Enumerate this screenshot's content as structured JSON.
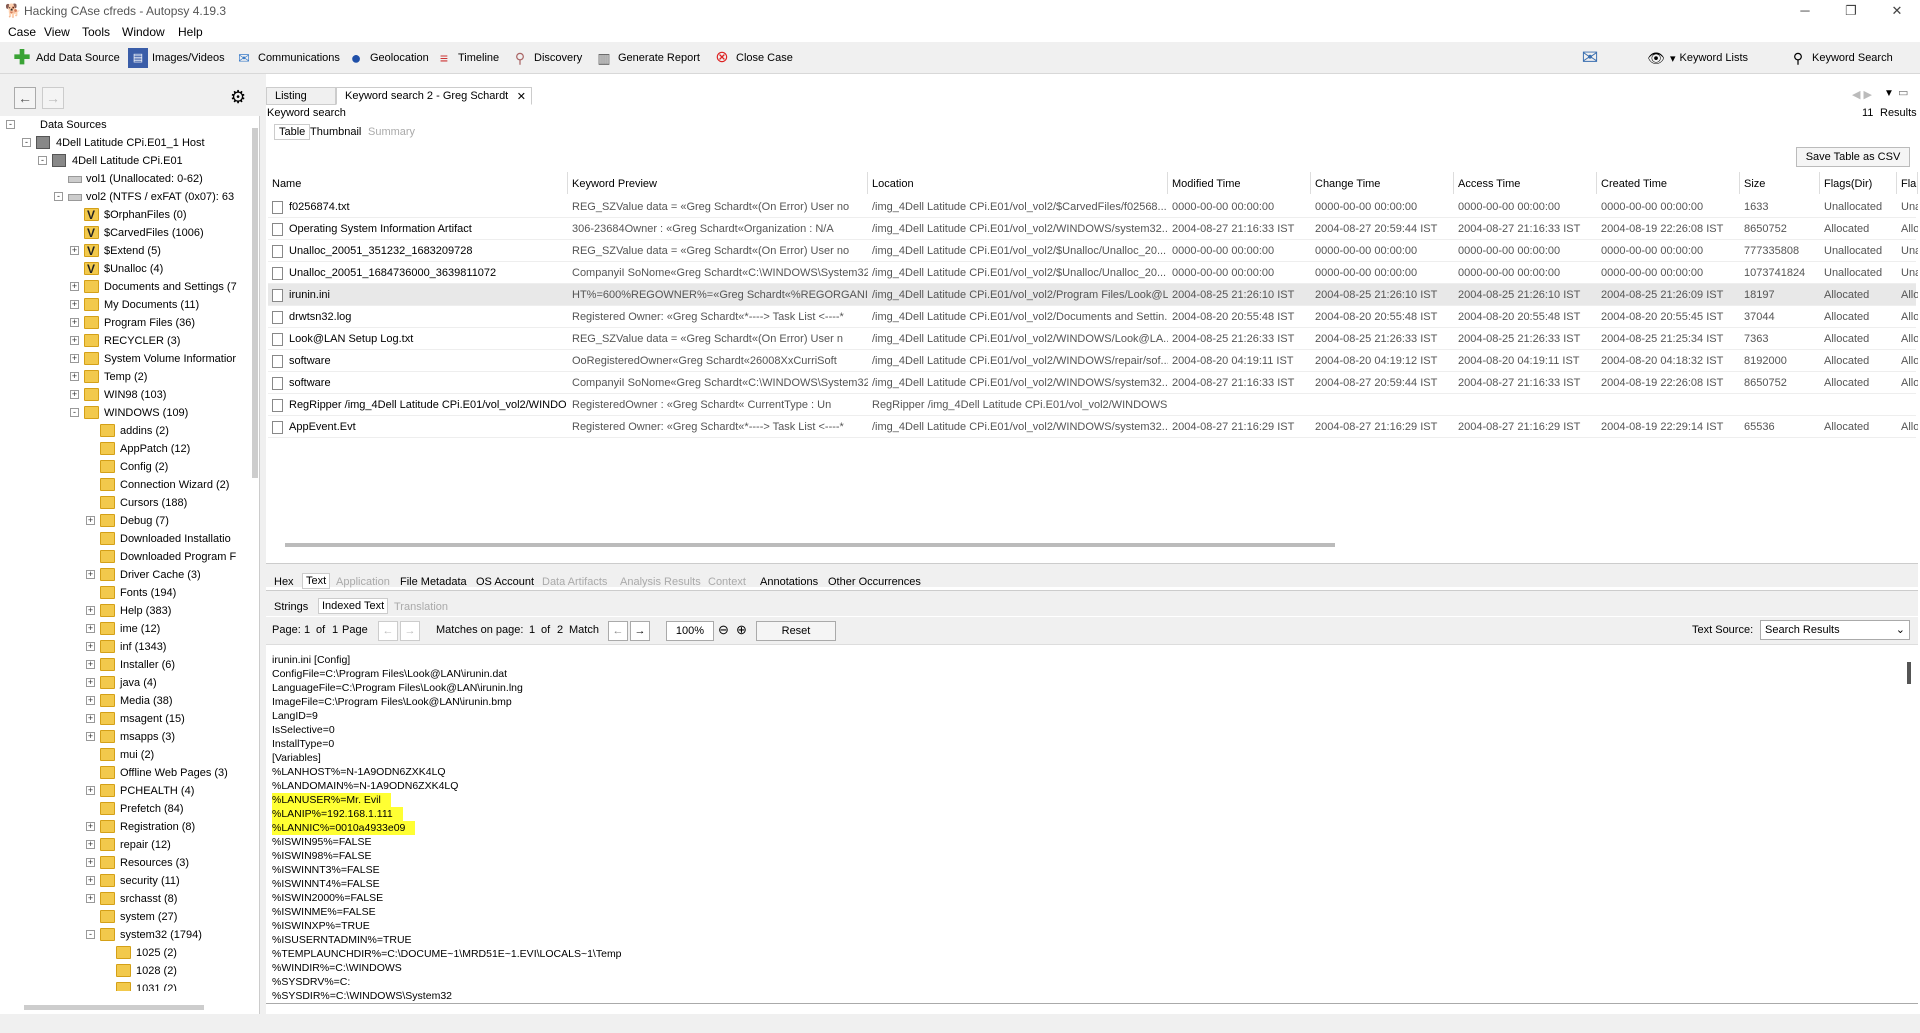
{
  "window": {
    "title": "Hacking CAse cfreds - Autopsy 4.19.3"
  },
  "menu": [
    "Case",
    "View",
    "Tools",
    "Window",
    "Help"
  ],
  "toolbar": {
    "items": [
      "Add Data Source",
      "Images/Videos",
      "Communications",
      "Geolocation",
      "Timeline",
      "Discovery",
      "Generate Report",
      "Close Case"
    ],
    "keyword_lists": "Keyword Lists",
    "keyword_search": "Keyword Search"
  },
  "tree": [
    {
      "label": "Data Sources",
      "depth": 0,
      "exp": "-",
      "icon": "none"
    },
    {
      "label": "4Dell Latitude CPi.E01_1 Host",
      "depth": 1,
      "exp": "-",
      "icon": "disk"
    },
    {
      "label": "4Dell Latitude CPi.E01",
      "depth": 2,
      "exp": "-",
      "icon": "disk"
    },
    {
      "label": "vol1 (Unallocated: 0-62)",
      "depth": 3,
      "exp": "",
      "icon": "vol"
    },
    {
      "label": "vol2 (NTFS / exFAT (0x07): 63",
      "depth": 3,
      "exp": "-",
      "icon": "vol"
    },
    {
      "label": "$OrphanFiles (0)",
      "depth": 4,
      "exp": "",
      "icon": "fv"
    },
    {
      "label": "$CarvedFiles (1006)",
      "depth": 4,
      "exp": "",
      "icon": "fv"
    },
    {
      "label": "$Extend (5)",
      "depth": 4,
      "exp": "+",
      "icon": "fv"
    },
    {
      "label": "$Unalloc (4)",
      "depth": 4,
      "exp": "",
      "icon": "fv"
    },
    {
      "label": "Documents and Settings (7",
      "depth": 4,
      "exp": "+",
      "icon": "f"
    },
    {
      "label": "My Documents (11)",
      "depth": 4,
      "exp": "+",
      "icon": "f"
    },
    {
      "label": "Program Files (36)",
      "depth": 4,
      "exp": "+",
      "icon": "f"
    },
    {
      "label": "RECYCLER (3)",
      "depth": 4,
      "exp": "+",
      "icon": "f"
    },
    {
      "label": "System Volume Informatior",
      "depth": 4,
      "exp": "+",
      "icon": "f"
    },
    {
      "label": "Temp (2)",
      "depth": 4,
      "exp": "+",
      "icon": "f"
    },
    {
      "label": "WIN98 (103)",
      "depth": 4,
      "exp": "+",
      "icon": "f"
    },
    {
      "label": "WINDOWS (109)",
      "depth": 4,
      "exp": "-",
      "icon": "f"
    },
    {
      "label": "addins (2)",
      "depth": 5,
      "exp": "",
      "icon": "f"
    },
    {
      "label": "AppPatch (12)",
      "depth": 5,
      "exp": "",
      "icon": "f"
    },
    {
      "label": "Config (2)",
      "depth": 5,
      "exp": "",
      "icon": "f"
    },
    {
      "label": "Connection Wizard (2)",
      "depth": 5,
      "exp": "",
      "icon": "f"
    },
    {
      "label": "Cursors (188)",
      "depth": 5,
      "exp": "",
      "icon": "f"
    },
    {
      "label": "Debug (7)",
      "depth": 5,
      "exp": "+",
      "icon": "f"
    },
    {
      "label": "Downloaded Installatio",
      "depth": 5,
      "exp": "",
      "icon": "f"
    },
    {
      "label": "Downloaded Program F",
      "depth": 5,
      "exp": "",
      "icon": "f"
    },
    {
      "label": "Driver Cache (3)",
      "depth": 5,
      "exp": "+",
      "icon": "f"
    },
    {
      "label": "Fonts (194)",
      "depth": 5,
      "exp": "",
      "icon": "f"
    },
    {
      "label": "Help (383)",
      "depth": 5,
      "exp": "+",
      "icon": "f"
    },
    {
      "label": "ime (12)",
      "depth": 5,
      "exp": "+",
      "icon": "f"
    },
    {
      "label": "inf (1343)",
      "depth": 5,
      "exp": "+",
      "icon": "f"
    },
    {
      "label": "Installer (6)",
      "depth": 5,
      "exp": "+",
      "icon": "f"
    },
    {
      "label": "java (4)",
      "depth": 5,
      "exp": "+",
      "icon": "f"
    },
    {
      "label": "Media (38)",
      "depth": 5,
      "exp": "+",
      "icon": "f"
    },
    {
      "label": "msagent (15)",
      "depth": 5,
      "exp": "+",
      "icon": "f"
    },
    {
      "label": "msapps (3)",
      "depth": 5,
      "exp": "+",
      "icon": "f"
    },
    {
      "label": "mui (2)",
      "depth": 5,
      "exp": "",
      "icon": "f"
    },
    {
      "label": "Offline Web Pages (3)",
      "depth": 5,
      "exp": "",
      "icon": "f"
    },
    {
      "label": "PCHEALTH (4)",
      "depth": 5,
      "exp": "+",
      "icon": "f"
    },
    {
      "label": "Prefetch (84)",
      "depth": 5,
      "exp": "",
      "icon": "f"
    },
    {
      "label": "Registration (8)",
      "depth": 5,
      "exp": "+",
      "icon": "f"
    },
    {
      "label": "repair (12)",
      "depth": 5,
      "exp": "+",
      "icon": "f"
    },
    {
      "label": "Resources (3)",
      "depth": 5,
      "exp": "+",
      "icon": "f"
    },
    {
      "label": "security (11)",
      "depth": 5,
      "exp": "+",
      "icon": "f"
    },
    {
      "label": "srchasst (8)",
      "depth": 5,
      "exp": "+",
      "icon": "f"
    },
    {
      "label": "system (27)",
      "depth": 5,
      "exp": "",
      "icon": "f"
    },
    {
      "label": "system32 (1794)",
      "depth": 5,
      "exp": "-",
      "icon": "f"
    },
    {
      "label": "1025 (2)",
      "depth": 6,
      "exp": "",
      "icon": "f"
    },
    {
      "label": "1028 (2)",
      "depth": 6,
      "exp": "",
      "icon": "f"
    },
    {
      "label": "1031 (2)",
      "depth": 6,
      "exp": "",
      "icon": "f"
    }
  ],
  "tabs": {
    "listing": "Listing",
    "keyword": "Keyword search 2 - Greg Schardt",
    "close": "✕"
  },
  "results": {
    "header": "Keyword search",
    "count": "11",
    "results_label": "Results",
    "subtabs": [
      "Table",
      "Thumbnail",
      "Summary"
    ],
    "save_csv": "Save Table as CSV"
  },
  "columns": [
    "Name",
    "Keyword Preview",
    "Location",
    "Modified Time",
    "Change Time",
    "Access Time",
    "Created Time",
    "Size",
    "Flags(Dir)",
    "Fla"
  ],
  "rows": [
    [
      "f0256874.txt",
      "REG_SZValue data = «Greg Schardt«(On Error) User no",
      "/img_4Dell Latitude CPi.E01/vol_vol2/$CarvedFiles/f02568...",
      "0000-00-00 00:00:00",
      "0000-00-00 00:00:00",
      "0000-00-00 00:00:00",
      "0000-00-00 00:00:00",
      "1633",
      "Unallocated",
      "Una"
    ],
    [
      "Operating System Information Artifact",
      "306-23684Owner : «Greg Schardt«Organization : N/A",
      "/img_4Dell Latitude CPi.E01/vol_vol2/WINDOWS/system32...",
      "2004-08-27 21:16:33 IST",
      "2004-08-27 20:59:44 IST",
      "2004-08-27 21:16:33 IST",
      "2004-08-19 22:26:08 IST",
      "8650752",
      "Allocated",
      "Allo"
    ],
    [
      "Unalloc_20051_351232_1683209728",
      "REG_SZValue data = «Greg Schardt«(On Error) User no",
      "/img_4Dell Latitude CPi.E01/vol_vol2/$Unalloc/Unalloc_20...",
      "0000-00-00 00:00:00",
      "0000-00-00 00:00:00",
      "0000-00-00 00:00:00",
      "0000-00-00 00:00:00",
      "777335808",
      "Unallocated",
      "Una"
    ],
    [
      "Unalloc_20051_1684736000_3639811072",
      "CompanyiI SoNome«Greg Schardt«C:\\WINDOWS\\System32...",
      "/img_4Dell Latitude CPi.E01/vol_vol2/$Unalloc/Unalloc_20...",
      "0000-00-00 00:00:00",
      "0000-00-00 00:00:00",
      "0000-00-00 00:00:00",
      "0000-00-00 00:00:00",
      "1073741824",
      "Unallocated",
      "Una"
    ],
    [
      "irunin.ini",
      "HT%=600%REGOWNER%=«Greg Schardt«%REGORGANI...",
      "/img_4Dell Latitude CPi.E01/vol_vol2/Program Files/Look@L...",
      "2004-08-25 21:26:10 IST",
      "2004-08-25 21:26:10 IST",
      "2004-08-25 21:26:10 IST",
      "2004-08-25 21:26:09 IST",
      "18197",
      "Allocated",
      "Allo"
    ],
    [
      "drwtsn32.log",
      "Registered Owner: «Greg Schardt«*----> Task List <----*",
      "/img_4Dell Latitude CPi.E01/vol_vol2/Documents and Settin...",
      "2004-08-20 20:55:48 IST",
      "2004-08-20 20:55:48 IST",
      "2004-08-20 20:55:48 IST",
      "2004-08-20 20:55:45 IST",
      "37044",
      "Allocated",
      "Allo"
    ],
    [
      "Look@LAN Setup Log.txt",
      "REG_SZValue data = «Greg Schardt«(On Error) User n",
      "/img_4Dell Latitude CPi.E01/vol_vol2/WINDOWS/Look@LA...",
      "2004-08-25 21:26:33 IST",
      "2004-08-25 21:26:33 IST",
      "2004-08-25 21:26:33 IST",
      "2004-08-25 21:25:34 IST",
      "7363",
      "Allocated",
      "Allo"
    ],
    [
      "software",
      "OoRegisteredOwner«Greg Schardt«26008XxCurriSoft",
      "/img_4Dell Latitude CPi.E01/vol_vol2/WINDOWS/repair/sof...",
      "2004-08-20 04:19:11 IST",
      "2004-08-20 04:19:12 IST",
      "2004-08-20 04:19:11 IST",
      "2004-08-20 04:18:32 IST",
      "8192000",
      "Allocated",
      "Allo"
    ],
    [
      "software",
      "CompanyiI SoNome«Greg Schardt«C:\\WINDOWS\\System32...",
      "/img_4Dell Latitude CPi.E01/vol_vol2/WINDOWS/system32...",
      "2004-08-27 21:16:33 IST",
      "2004-08-27 20:59:44 IST",
      "2004-08-27 21:16:33 IST",
      "2004-08-19 22:26:08 IST",
      "8650752",
      "Allocated",
      "Allo"
    ],
    [
      "RegRipper /img_4Dell Latitude CPi.E01/vol_vol2/WINDO",
      "RegisteredOwner : «Greg Schardt«  CurrentType : Un",
      "RegRipper /img_4Dell Latitude CPi.E01/vol_vol2/WINDOWS...",
      "",
      "",
      "",
      "",
      "",
      "",
      ""
    ],
    [
      "AppEvent.Evt",
      "Registered Owner: «Greg Schardt«*----> Task List <----*",
      "/img_4Dell Latitude CPi.E01/vol_vol2/WINDOWS/system32...",
      "2004-08-27 21:16:29 IST",
      "2004-08-27 21:16:29 IST",
      "2004-08-27 21:16:29 IST",
      "2004-08-19 22:29:14 IST",
      "65536",
      "Allocated",
      "Allo"
    ]
  ],
  "bottom_tabs": [
    "Hex",
    "Text",
    "Application",
    "File Metadata",
    "OS Account",
    "Data Artifacts",
    "Analysis Results",
    "Context",
    "Annotations",
    "Other Occurrences"
  ],
  "text_tabs": [
    "Strings",
    "Indexed Text",
    "Translation"
  ],
  "controls": {
    "page_label": "Page:",
    "page": "1",
    "of": "of",
    "pages": "1",
    "page_word": "Page",
    "matches_label": "Matches on page:",
    "match": "1",
    "matches_total": "2",
    "match_word": "Match",
    "zoom": "100%",
    "reset": "Reset",
    "text_source_label": "Text Source:",
    "text_source": "Search Results"
  },
  "text_lines": [
    "irunin.ini [Config]",
    "ConfigFile=C:\\Program Files\\Look@LAN\\irunin.dat",
    "LanguageFile=C:\\Program Files\\Look@LAN\\irunin.lng",
    "ImageFile=C:\\Program Files\\Look@LAN\\irunin.bmp",
    "LangID=9",
    "IsSelective=0",
    "InstallType=0",
    "[Variables]",
    "%LANHOST%=N-1A9ODN6ZXK4LQ",
    "%LANDOMAIN%=N-1A9ODN6ZXK4LQ",
    "%LANUSER%=Mr. Evil",
    "%LANIP%=192.168.1.111",
    "%LANNIC%=0010a4933e09",
    "%ISWIN95%=FALSE",
    "%ISWIN98%=FALSE",
    "%ISWINNT3%=FALSE",
    "%ISWINNT4%=FALSE",
    "%ISWIN2000%=FALSE",
    "%ISWINME%=FALSE",
    "%ISWINXP%=TRUE",
    "%ISUSERNTADMIN%=TRUE",
    "%TEMPLAUNCHDIR%=C:\\DOCUME~1\\MRD51E~1.EVI\\LOCALS~1\\Temp",
    "%WINDIR%=C:\\WINDOWS",
    "%SYSDRV%=C:",
    "%SYSDIR%=C:\\WINDOWS\\System32"
  ],
  "highlight_lines": [
    10,
    11,
    12
  ],
  "colors": {
    "highlight": "#ffff33",
    "accent": "#0a64a4"
  }
}
